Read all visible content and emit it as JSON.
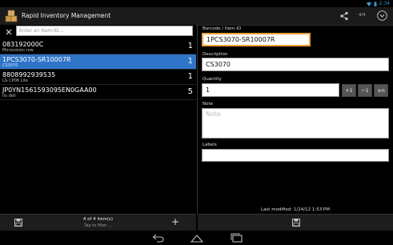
{
  "status": {
    "time": "2:34"
  },
  "app": {
    "title": "Rapid Inventory Management",
    "counter": "4/4"
  },
  "search": {
    "placeholder": "Enter an Item-ID...",
    "value": ""
  },
  "items": [
    {
      "code": "083192000C",
      "sub": "Microvision row",
      "qty": "1",
      "selected": false
    },
    {
      "code": "1PCS3070-SR10007R",
      "sub": "CS3070",
      "qty": "1",
      "selected": true
    },
    {
      "code": "8808992939535",
      "sub": "LG CP06 Lite",
      "qty": "1",
      "selected": false
    },
    {
      "code": "JP0YN1561593095EN0GAA00",
      "sub": "Its dell",
      "qty": "5",
      "selected": false
    }
  ],
  "detail": {
    "barcode_label": "Barcode / Item-ID",
    "barcode_value": "1PCS3070-SR10007R",
    "description_label": "Description",
    "description_value": "CS3070",
    "quantity_label": "Quantity",
    "quantity_value": "1",
    "qty_plus": "+1",
    "qty_minus": "−1",
    "qty_pm": "±n",
    "note_label": "Note",
    "note_placeholder": "Note",
    "labels_label": "Labels",
    "labels_value": "",
    "last_modified": "Last modified: 1/24/12 1:53 PM"
  },
  "bottom": {
    "count": "4 of 4 item(s)",
    "filter": "Tap to filter ...",
    "add": "+"
  },
  "colors": {
    "accent": "#2e75c8",
    "focus": "#e8a23c"
  }
}
